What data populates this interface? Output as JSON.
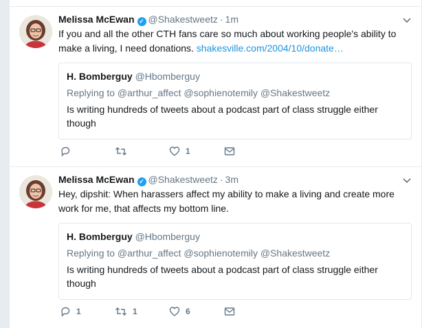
{
  "tweets": [
    {
      "author_name": "Melissa McEwan",
      "handle": "@Shakestweetz",
      "separator": "·",
      "time": "1m",
      "text": "If you and all the other CTH fans care so much about working people's ability to make a living, I need donations.",
      "link": "shakesville.com/2004/10/donate…",
      "quote": {
        "author_name": "H. Bomberguy",
        "handle": "@Hbomberguy",
        "replying_to": "Replying to @arthur_affect @sophienotemily @Shakestweetz",
        "text": "Is writing hundreds of tweets about a podcast part of class struggle either though"
      },
      "actions": {
        "reply_count": "",
        "retweet_count": "",
        "like_count": "1"
      }
    },
    {
      "author_name": "Melissa McEwan",
      "handle": "@Shakestweetz",
      "separator": "·",
      "time": "3m",
      "text": "Hey, dipshit: When harassers affect my ability to make a living and create more work for me, that affects my bottom line.",
      "link": "",
      "quote": {
        "author_name": "H. Bomberguy",
        "handle": "@Hbomberguy",
        "replying_to": "Replying to @arthur_affect @sophienotemily @Shakestweetz",
        "text": "Is writing hundreds of tweets about a podcast part of class struggle either though"
      },
      "actions": {
        "reply_count": "1",
        "retweet_count": "1",
        "like_count": "6"
      }
    }
  ],
  "icons": {
    "verified": "verified-badge-icon",
    "caret": "chevron-down-icon",
    "reply": "reply-icon",
    "retweet": "retweet-icon",
    "like": "heart-icon",
    "dm": "direct-message-icon"
  },
  "colors": {
    "link": "#1b95e0",
    "verified": "#1da1f2",
    "muted": "#657786",
    "border": "#e1e8ed",
    "background": "#e6ecf0"
  }
}
